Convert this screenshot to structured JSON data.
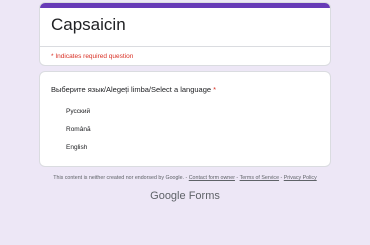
{
  "form": {
    "title": "Capsaicin",
    "required_note": "* Indicates required question",
    "accent_color": "#673ab7",
    "background_color": "#ede7f6"
  },
  "question": {
    "label": "Выберите язык/Alegeți limba/Select a language",
    "required_mark": "*",
    "options": [
      "Русский",
      "Română",
      "English"
    ]
  },
  "footer": {
    "disclaimer": "This content is neither created nor endorsed by Google. -",
    "link_contact": "Contact form owner",
    "sep1": " - ",
    "link_terms": "Terms of Service",
    "sep2": " - ",
    "link_privacy": "Privacy Policy"
  },
  "logo": {
    "google": "Google",
    "forms": "Forms"
  }
}
